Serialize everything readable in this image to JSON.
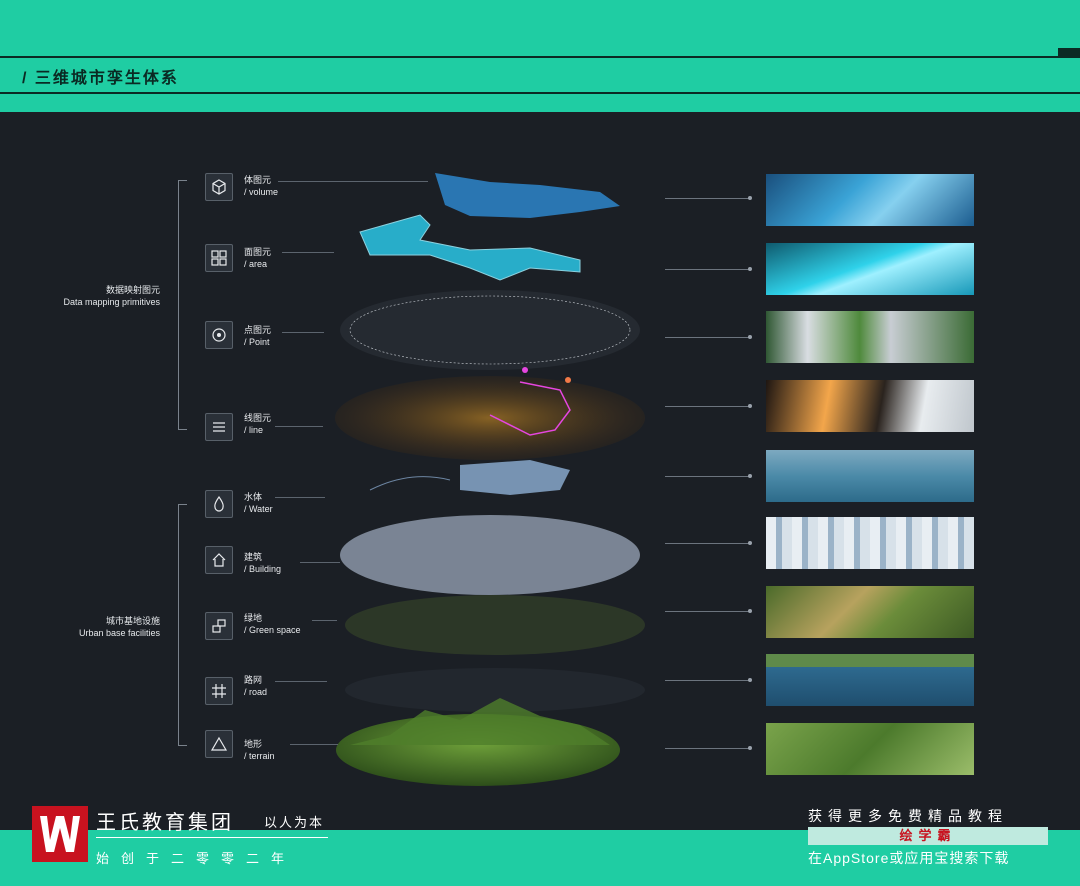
{
  "header": {
    "title": "/  三维城市孪生体系"
  },
  "groups": [
    {
      "zh": "数据映射图元",
      "en": "Data mapping primitives"
    },
    {
      "zh": "城市基地设施",
      "en": "Urban base facilities"
    }
  ],
  "items": [
    {
      "zh": "体图元",
      "en": "/ volume",
      "icon": "cube-icon"
    },
    {
      "zh": "面图元",
      "en": "/ area",
      "icon": "grid-icon"
    },
    {
      "zh": "点图元",
      "en": "/ Point",
      "icon": "target-icon"
    },
    {
      "zh": "线图元",
      "en": "/ line",
      "icon": "lines-icon"
    },
    {
      "zh": "水体",
      "en": "/ Water",
      "icon": "drop-icon"
    },
    {
      "zh": "建筑",
      "en": "/ Building",
      "icon": "house-icon"
    },
    {
      "zh": "绿地",
      "en": "/ Green space",
      "icon": "blocks-icon"
    },
    {
      "zh": "路网",
      "en": "/ road",
      "icon": "hash-icon"
    },
    {
      "zh": "地形",
      "en": "/ terrain",
      "icon": "triangle-icon"
    }
  ],
  "colors": {
    "accent": "#1fcda3",
    "background": "#1b1f25",
    "brand_red": "#c8121f"
  },
  "footer": {
    "brand_name": "王氏教育集团",
    "brand_slogan": "以人为本",
    "brand_year": "始创于二零零二年",
    "promo_top": "获得更多免费精品教程",
    "promo_bar": "绘学霸",
    "promo_bottom": "在AppStore或应用宝搜索下载"
  }
}
